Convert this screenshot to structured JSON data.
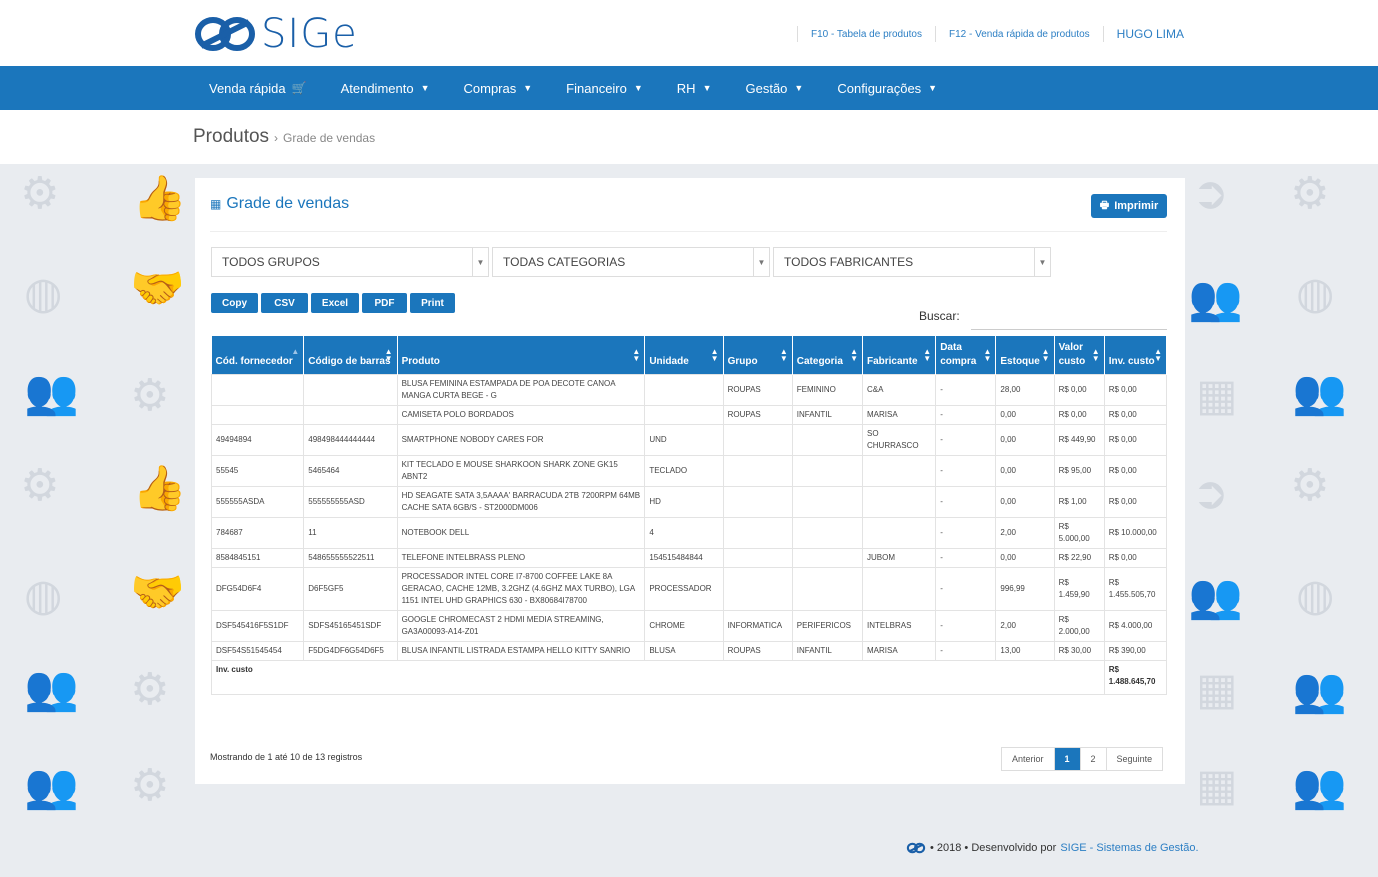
{
  "brand": {
    "name": "SIGe"
  },
  "toplinks": {
    "f10": "F10 - Tabela de produtos",
    "f12": "F12 - Venda rápida de produtos",
    "user": "HUGO LIMA"
  },
  "nav": [
    {
      "label": "Venda rápida",
      "icon": "cart-icon"
    },
    {
      "label": "Atendimento",
      "icon": "chevron-down-icon"
    },
    {
      "label": "Compras",
      "icon": "chevron-down-icon"
    },
    {
      "label": "Financeiro",
      "icon": "chevron-down-icon"
    },
    {
      "label": "RH",
      "icon": "chevron-down-icon"
    },
    {
      "label": "Gestão",
      "icon": "chevron-down-icon"
    },
    {
      "label": "Configurações",
      "icon": "chevron-down-icon"
    }
  ],
  "breadcrumb": {
    "main": "Produtos",
    "sep": "›",
    "sub": "Grade de vendas"
  },
  "panel": {
    "title": "Grade de vendas",
    "print_label": "Imprimir"
  },
  "filters": {
    "groups": "TODOS GRUPOS",
    "categories": "TODAS CATEGORIAS",
    "manufacturers": "TODOS FABRICANTES"
  },
  "export_buttons": [
    "Copy",
    "CSV",
    "Excel",
    "PDF",
    "Print"
  ],
  "search": {
    "label": "Buscar:",
    "value": ""
  },
  "table": {
    "columns": [
      "Cód. fornecedor",
      "Código de barras",
      "Produto",
      "Unidade",
      "Grupo",
      "Categoria",
      "Fabricante",
      "Data compra",
      "Estoque",
      "Valor custo",
      "Inv. custo"
    ],
    "rows": [
      [
        "",
        "",
        "BLUSA FEMININA ESTAMPADA DE POA DECOTE CANOA MANGA CURTA BEGE - G",
        "",
        "ROUPAS",
        "FEMININO",
        "C&A",
        "-",
        "28,00",
        "R$ 0,00",
        "R$ 0,00"
      ],
      [
        "",
        "",
        "CAMISETA POLO BORDADOS",
        "",
        "ROUPAS",
        "INFANTIL",
        "MARISA",
        "-",
        "0,00",
        "R$ 0,00",
        "R$ 0,00"
      ],
      [
        "49494894",
        "498498444444444",
        "SMARTPHONE NOBODY CARES FOR",
        "UND",
        "",
        "",
        "SO CHURRASCO",
        "-",
        "0,00",
        "R$ 449,90",
        "R$ 0,00"
      ],
      [
        "55545",
        "5465464",
        "KIT TECLADO E MOUSE SHARKOON SHARK ZONE GK15 ABNT2",
        "TECLADO",
        "",
        "",
        "",
        "-",
        "0,00",
        "R$ 95,00",
        "R$ 0,00"
      ],
      [
        "555555ASDA",
        "555555555ASD",
        "HD SEAGATE SATA 3,5AAAA' BARRACUDA 2TB 7200RPM 64MB CACHE SATA 6GB/S - ST2000DM006",
        "HD",
        "",
        "",
        "",
        "-",
        "0,00",
        "R$ 1,00",
        "R$ 0,00"
      ],
      [
        "784687",
        "11",
        "NOTEBOOK DELL",
        "4",
        "",
        "",
        "",
        "-",
        "2,00",
        "R$ 5.000,00",
        "R$ 10.000,00"
      ],
      [
        "8584845151",
        "548655555522511",
        "TELEFONE INTELBRASS PLENO",
        "154515484844",
        "",
        "",
        "JUBOM",
        "-",
        "0,00",
        "R$ 22,90",
        "R$ 0,00"
      ],
      [
        "DFG54D6F4",
        "D6F5GF5",
        "PROCESSADOR INTEL CORE I7-8700 COFFEE LAKE 8A GERACAO, CACHE 12MB, 3.2GHZ (4.6GHZ MAX TURBO), LGA 1151 INTEL UHD GRAPHICS 630 - BX80684I78700",
        "PROCESSADOR",
        "",
        "",
        "",
        "-",
        "996,99",
        "R$ 1.459,90",
        "R$ 1.455.505,70"
      ],
      [
        "DSF545416F5S1DF",
        "SDFS45165451SDF",
        "GOOGLE CHROMECAST 2 HDMI MEDIA STREAMING, GA3A00093-A14-Z01",
        "CHROME",
        "INFORMATICA",
        "PERIFERICOS",
        "INTELBRAS",
        "-",
        "2,00",
        "R$ 2.000,00",
        "R$ 4.000,00"
      ],
      [
        "DSF54S51545454",
        "F5DG4DF6G54D6F5",
        "BLUSA INFANTIL LISTRADA ESTAMPA HELLO KITTY SANRIO",
        "BLUSA",
        "ROUPAS",
        "INFANTIL",
        "MARISA",
        "-",
        "13,00",
        "R$ 30,00",
        "R$ 390,00"
      ]
    ],
    "footer_label": "Inv. custo",
    "footer_total": "R$ 1.488.645,70"
  },
  "info": "Mostrando de 1 até 10 de 13 registros",
  "pagination": {
    "prev": "Anterior",
    "pages": [
      "1",
      "2"
    ],
    "current": "1",
    "next": "Seguinte"
  },
  "footer": {
    "text": "• 2018 • Desenvolvido por",
    "link": "SIGE - Sistemas de Gestão."
  },
  "colors": {
    "primary": "#1b76bc",
    "link": "#2d7fc4",
    "background": "#e9ecf0"
  }
}
